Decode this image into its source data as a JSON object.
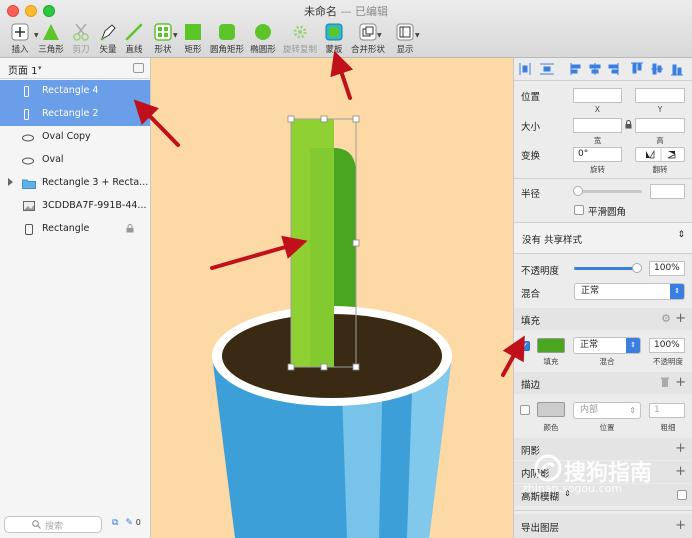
{
  "window": {
    "title": "未命名",
    "subtitle": "— 已编辑"
  },
  "toolbar": {
    "items": [
      {
        "label": "插入",
        "icon": "plus-icon"
      },
      {
        "label": "三角形",
        "icon": "triangle-icon"
      },
      {
        "label": "剪刀",
        "icon": "scissors-icon"
      },
      {
        "label": "矢量",
        "icon": "pen-icon"
      },
      {
        "label": "直线",
        "icon": "line-icon"
      },
      {
        "label": "形状",
        "icon": "shapes-icon"
      },
      {
        "label": "矩形",
        "icon": "rectangle-icon"
      },
      {
        "label": "圆角矩形",
        "icon": "rounded-rectangle-icon"
      },
      {
        "label": "椭圆形",
        "icon": "oval-icon"
      },
      {
        "label": "旋转复制",
        "icon": "rotate-copy-icon"
      },
      {
        "label": "蒙板",
        "icon": "mask-icon"
      },
      {
        "label": "合并形状",
        "icon": "combine-shapes-icon"
      },
      {
        "label": "显示",
        "icon": "display-icon"
      }
    ]
  },
  "sidebar": {
    "page_label": "页面 1",
    "layers": [
      {
        "name": "Rectangle 4",
        "icon": "rectangle-layer-icon",
        "selected": true
      },
      {
        "name": "Rectangle 2",
        "icon": "rectangle-layer-icon",
        "selected": true
      },
      {
        "name": "Oval Copy",
        "icon": "oval-layer-icon",
        "selected": false
      },
      {
        "name": "Oval",
        "icon": "oval-layer-icon",
        "selected": false
      },
      {
        "name": "Rectangle 3 + Recta...",
        "icon": "folder-icon",
        "selected": false
      },
      {
        "name": "3CDDBA7F-991B-44...",
        "icon": "image-layer-icon",
        "selected": false
      },
      {
        "name": "Rectangle",
        "icon": "rectangle-layer-icon",
        "selected": false,
        "locked": true
      }
    ],
    "search_placeholder": "搜索",
    "footer_count": "0"
  },
  "inspector": {
    "position_label": "位置",
    "x_label": "X",
    "y_label": "Y",
    "size_label": "大小",
    "width_label": "宽",
    "height_label": "高",
    "transform_label": "变换",
    "rotation_value": "0°",
    "rotate_label": "旋转",
    "flip_label": "翻转",
    "radius_label": "半径",
    "smooth_corners_label": "平滑圆角",
    "shared_style": "没有 共享样式",
    "opacity_label": "不透明度",
    "opacity_value": "100%",
    "opacity_level": 1.0,
    "blend_label": "混合",
    "blend_value": "正常",
    "fill_section": "填充",
    "fill": {
      "color": "#4aa521",
      "enabled": true,
      "blend_value": "正常",
      "opacity_value": "100%",
      "color_label": "填充",
      "blend_label": "混合",
      "opacity_label": "不透明度"
    },
    "border_section": "描边",
    "border": {
      "color": "#cccccc",
      "enabled": false,
      "position_value": "内部",
      "width_value": "1",
      "color_label": "颜色",
      "position_label": "位置",
      "width_label": "粗细"
    },
    "shadow_section": "阴影",
    "inner_shadow_section": "内阴影",
    "blur_section": "高斯模糊",
    "export_section": "导出图层"
  },
  "watermark": {
    "brand": "搜狗指南",
    "url": "zhinan.sogou.com"
  },
  "colors": {
    "canvas_bg": "#fcd9a5",
    "selection": "#6b9ee8",
    "leaf_light": "#8fd133",
    "leaf_dark": "#4aa521",
    "pot_blue": "#3d9fd8",
    "soil": "#3b2a13",
    "arrow_red": "#c0101a"
  }
}
